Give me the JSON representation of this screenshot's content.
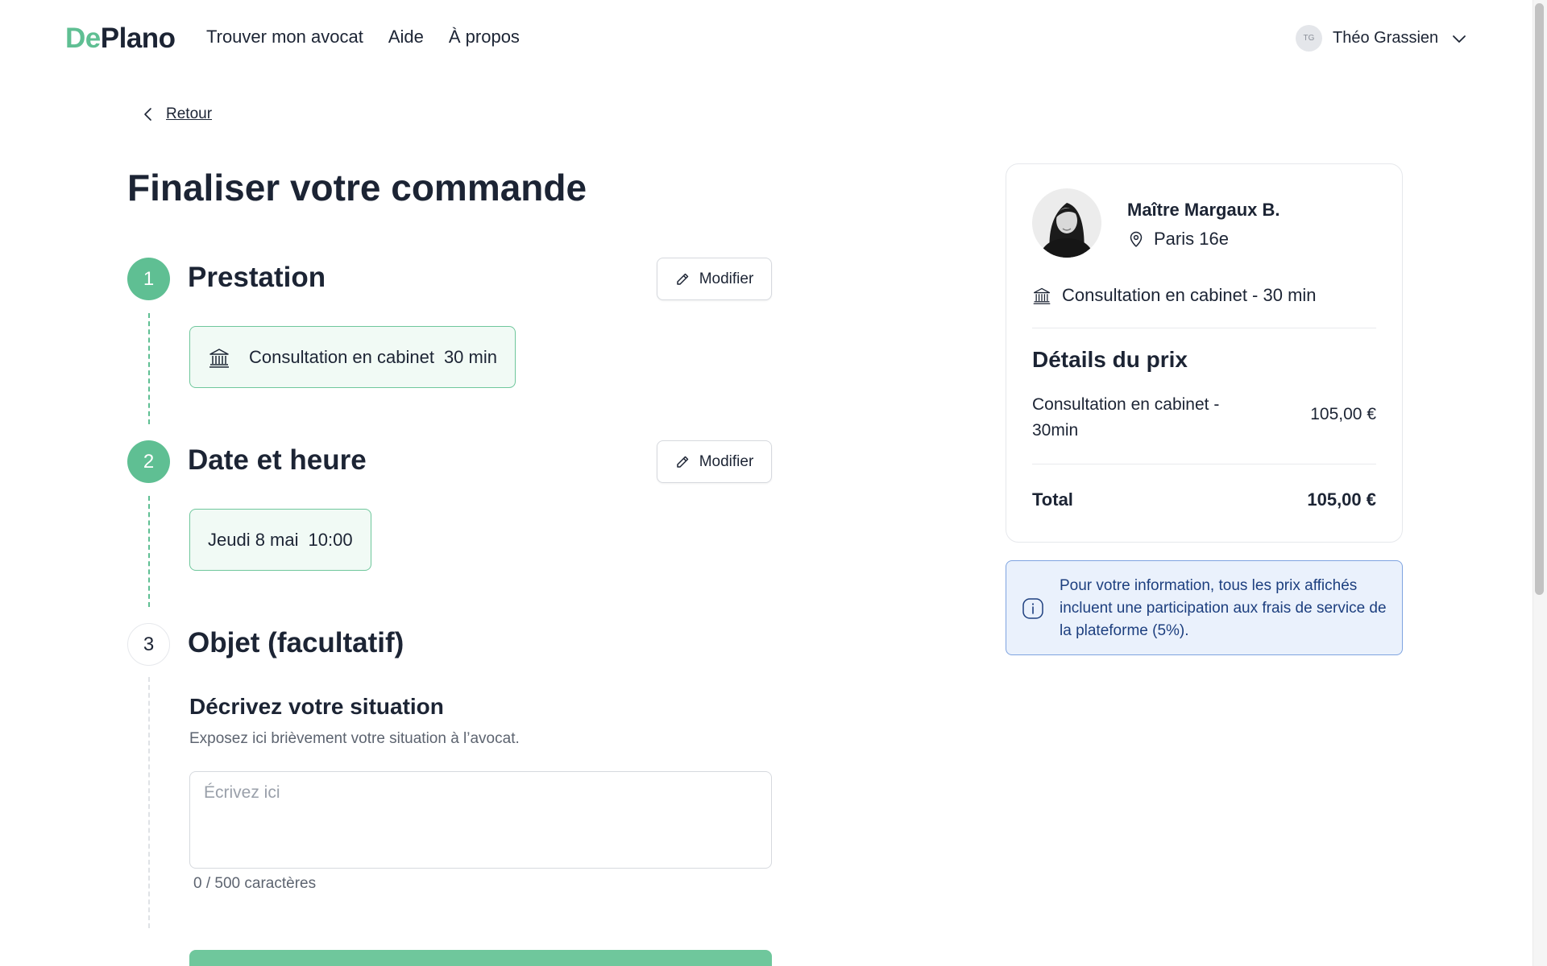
{
  "header": {
    "logo_part1": "De",
    "logo_part2": "Plano",
    "nav": [
      "Trouver mon avocat",
      "Aide",
      "À propos"
    ],
    "user": {
      "initials": "TG",
      "name": "Théo Grassien"
    }
  },
  "back": {
    "label": "Retour"
  },
  "page_title": "Finaliser votre commande",
  "steps": [
    {
      "number": "1",
      "title": "Prestation",
      "modify_label": "Modifier",
      "chip_label": "Consultation en cabinet",
      "chip_detail": "30 min",
      "chip_icon": "bank-icon"
    },
    {
      "number": "2",
      "title": "Date et heure",
      "modify_label": "Modifier",
      "chip_label": "Jeudi 8 mai",
      "chip_detail": "10:00"
    },
    {
      "number": "3",
      "title": "Objet (facultatif)",
      "section_title": "Décrivez votre situation",
      "section_desc": "Exposez ici brièvement votre situation à l’avocat.",
      "textarea_placeholder": "Écrivez ici",
      "counter": "0 / 500 caractères"
    }
  ],
  "summary": {
    "lawyer_name": "Maître Margaux B.",
    "location": "Paris 16e",
    "service": "Consultation en cabinet - 30 min",
    "price_title": "Détails du prix",
    "line_label": "Consultation en cabinet - 30min",
    "line_value": "105,00 €",
    "total_label": "Total",
    "total_value": "105,00 €"
  },
  "info": {
    "text": "Pour votre information, tous les prix affichés incluent une participation aux frais de service de la plateforme (5%)."
  },
  "colors": {
    "accent": "#5fbf93",
    "chip_bg": "#f1faf5",
    "text": "#1c2434",
    "info_bg": "#eaf1fc",
    "info_text": "#1d3f7f"
  }
}
